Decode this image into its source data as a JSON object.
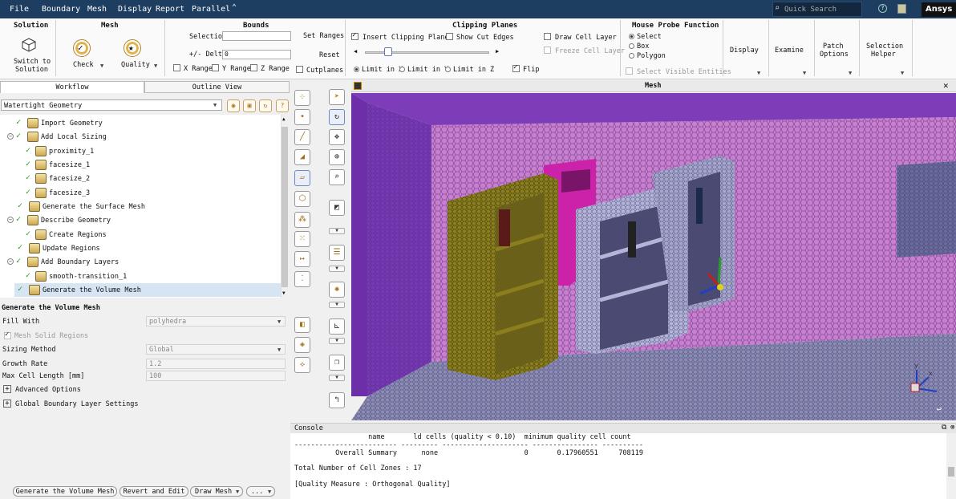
{
  "menu": [
    "File",
    "Boundary",
    "Mesh",
    "Display",
    "Report",
    "Parallel",
    "⌃"
  ],
  "search_placeholder": "Quick Search",
  "brand": "Ansys",
  "ribbon": {
    "solution": {
      "title": "Solution",
      "switch_label_1": "Switch to",
      "switch_label_2": "Solution"
    },
    "mesh": {
      "title": "Mesh",
      "check": "Check",
      "quality": "Quality"
    },
    "bounds": {
      "title": "Bounds",
      "selection": "Selection",
      "delta": "+/- Delta",
      "delta_value": "0",
      "x_range": "X Range",
      "y_range": "Y Range",
      "z_range": "Z Range",
      "set_ranges": "Set Ranges",
      "reset": "Reset",
      "cutplanes": "Cutplanes"
    },
    "clipping": {
      "title": "Clipping Planes",
      "insert": "Insert Clipping Planes",
      "show_cut": "Show Cut Edges",
      "draw_cell": "Draw Cell Layer",
      "freeze_cell": "Freeze Cell Layer",
      "limit_x": "Limit in X",
      "limit_y": "Limit in Y",
      "limit_z": "Limit in Z",
      "flip": "Flip"
    },
    "probe": {
      "title": "Mouse Probe Function",
      "select": "Select",
      "box": "Box",
      "polygon": "Polygon",
      "select_visible": "Select Visible Entities"
    },
    "display": "Display",
    "examine": "Examine",
    "patch_1": "Patch",
    "patch_2": "Options",
    "selhelper_1": "Selection",
    "selhelper_2": "Helper"
  },
  "tabs": {
    "workflow": "Workflow",
    "outline": "Outline View"
  },
  "workflow_type": "Watertight Geometry",
  "tree": [
    {
      "label": "Import Geometry"
    },
    {
      "label": "Add Local Sizing"
    },
    {
      "label": "proximity_1"
    },
    {
      "label": "facesize_1"
    },
    {
      "label": "facesize_2"
    },
    {
      "label": "facesize_3"
    },
    {
      "label": "Generate the Surface Mesh"
    },
    {
      "label": "Describe Geometry"
    },
    {
      "label": "Create Regions"
    },
    {
      "label": "Update Regions"
    },
    {
      "label": "Add Boundary Layers"
    },
    {
      "label": "smooth-transition_1"
    },
    {
      "label": "Generate the Volume Mesh"
    }
  ],
  "props": {
    "title": "Generate the Volume Mesh",
    "fill_with": "Fill With",
    "fill_with_value": "polyhedra",
    "mesh_solid": "Mesh Solid Regions",
    "sizing": "Sizing Method",
    "sizing_value": "Global",
    "growth": "Growth Rate",
    "growth_value": "1.2",
    "maxcell": "Max Cell Length [mm]",
    "maxcell_value": "100",
    "advanced": "Advanced Options",
    "global_bl": "Global Boundary Layer Settings"
  },
  "buttons": {
    "generate": "Generate the Volume Mesh",
    "revert": "Revert and Edit",
    "draw": "Draw Mesh",
    "more": "..."
  },
  "viewport_title": "Mesh",
  "console": {
    "title": "Console",
    "lines": [
      "                  name       ld cells (quality < 0.10)  minimum quality cell count",
      "------------------------- --------- --------------------- ---------------- ----------",
      "          Overall Summary      none                     0       0.17960551     708119",
      "",
      "Total Number of Cell Zones : 17",
      "",
      "[Quality Measure : Orthogonal Quality]"
    ]
  }
}
